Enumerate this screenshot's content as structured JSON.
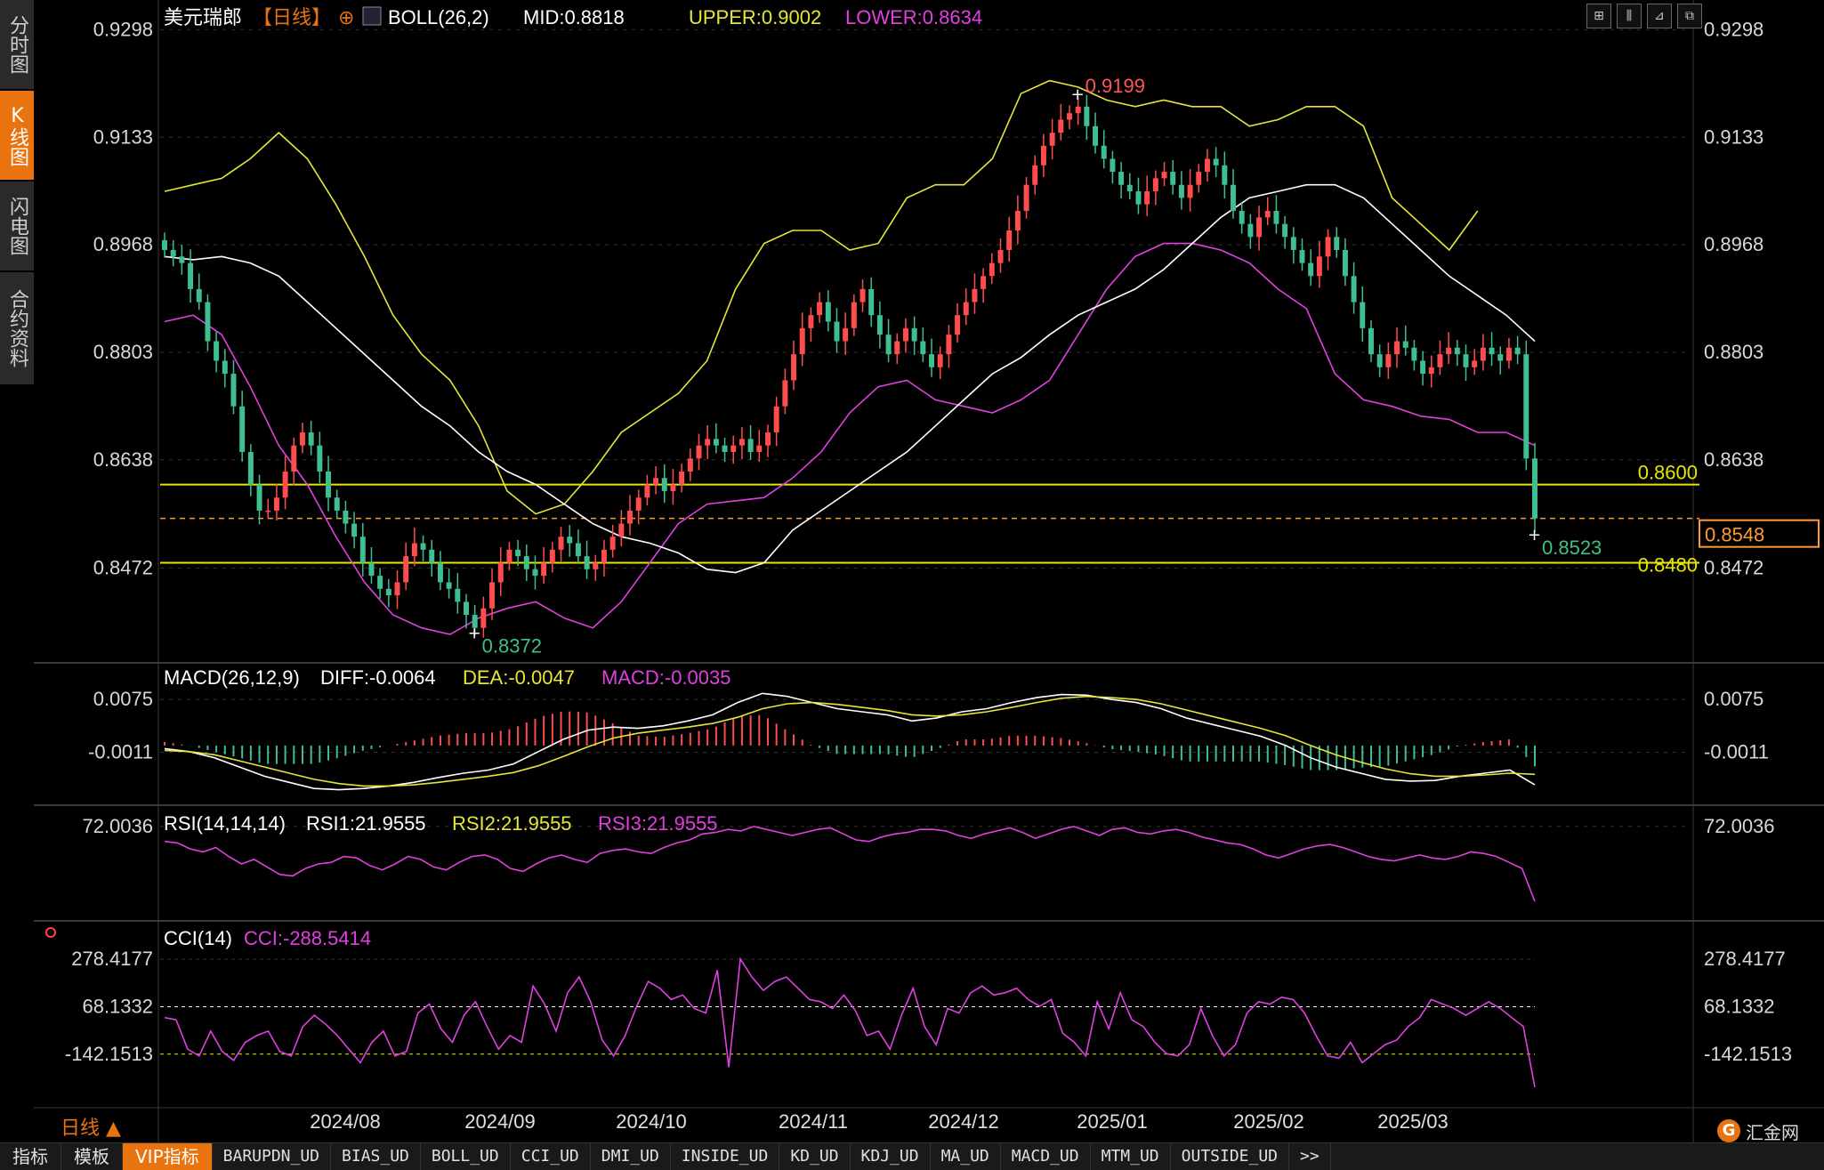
{
  "side_tabs": [
    {
      "label": "分时图",
      "active": false
    },
    {
      "label": "K线图",
      "active": true
    },
    {
      "label": "闪电图",
      "active": false
    },
    {
      "label": "合约资料",
      "active": false
    }
  ],
  "header": {
    "symbol": "美元瑞郎",
    "period": "【日线】",
    "plus_icon": "⊕",
    "boll": "BOLL(26,2)",
    "mid": "MID:0.8818",
    "upper": "UPPER:0.9002",
    "lower": "LOWER:0.8634"
  },
  "macd_header": {
    "name": "MACD(26,12,9)",
    "diff": "DIFF:-0.0064",
    "dea": "DEA:-0.0047",
    "macd": "MACD:-0.0035"
  },
  "rsi_header": {
    "name": "RSI(14,14,14)",
    "rsi1": "RSI1:21.9555",
    "rsi2": "RSI2:21.9555",
    "rsi3": "RSI3:21.9555"
  },
  "cci_header": {
    "name": "CCI(14)",
    "cci": "CCI:-288.5414"
  },
  "period_label": "日线 ▲",
  "toolbar_icons": [
    "crosshair-icon",
    "candle-icon",
    "chart-icon",
    "fullscreen-icon"
  ],
  "bottom_tabs": [
    {
      "label": "指标",
      "active": false
    },
    {
      "label": "模板",
      "active": false
    },
    {
      "label": "VIP指标",
      "active": true
    },
    {
      "label": "BARUPDN_UD",
      "active": false
    },
    {
      "label": "BIAS_UD",
      "active": false
    },
    {
      "label": "BOLL_UD",
      "active": false
    },
    {
      "label": "CCI_UD",
      "active": false
    },
    {
      "label": "DMI_UD",
      "active": false
    },
    {
      "label": "INSIDE_UD",
      "active": false
    },
    {
      "label": "KD_UD",
      "active": false
    },
    {
      "label": "KDJ_UD",
      "active": false
    },
    {
      "label": "MA_UD",
      "active": false
    },
    {
      "label": "MACD_UD",
      "active": false
    },
    {
      "label": "MTM_UD",
      "active": false
    },
    {
      "label": "OUTSIDE_UD",
      "active": false
    },
    {
      "label": ">>",
      "active": false
    }
  ],
  "logo": {
    "text": "汇金网",
    "mark": "G"
  },
  "colors": {
    "up": "#ff4d4d",
    "down": "#3fbf8f",
    "mid": "#ffffff",
    "upper": "#e6e63a",
    "lower": "#e040e0",
    "dea": "#e6e63a",
    "macd": "#e040e0",
    "rsi": "#e040e0",
    "cci": "#e040e0",
    "hline": "#e6e600",
    "price_line": "#ff9933",
    "high_label": "#ff5555",
    "low_label": "#40c080"
  },
  "chart_data": {
    "type": "candlestick",
    "x_ticks": [
      "2024/08",
      "2024/09",
      "2024/10",
      "2024/11",
      "2024/12",
      "2025/01",
      "2025/02",
      "2025/03"
    ],
    "price_axis": {
      "ticks": [
        "0.9298",
        "0.9133",
        "0.8968",
        "0.8803",
        "0.8638",
        "0.8472"
      ],
      "range": [
        0.834,
        0.933
      ]
    },
    "horizontal_lines": [
      {
        "value": 0.86,
        "label": "0.8600"
      },
      {
        "value": 0.848,
        "label": "0.8480"
      }
    ],
    "current_price": {
      "value": 0.8548,
      "label": "0.8548"
    },
    "annotations": [
      {
        "label": "0.9199",
        "value": 0.9199,
        "type": "high",
        "index": 106
      },
      {
        "label": "0.8372",
        "value": 0.8372,
        "type": "low",
        "index": 36
      },
      {
        "label": "0.8523",
        "value": 0.8523,
        "type": "last-low",
        "index": 159
      }
    ],
    "boll": {
      "mid": [
        0.895,
        0.8945,
        0.895,
        0.894,
        0.892,
        0.888,
        0.884,
        0.88,
        0.876,
        0.872,
        0.869,
        0.865,
        0.862,
        0.86,
        0.857,
        0.854,
        0.852,
        0.851,
        0.8495,
        0.847,
        0.8465,
        0.848,
        0.853,
        0.856,
        0.859,
        0.862,
        0.865,
        0.869,
        0.873,
        0.877,
        0.8795,
        0.883,
        0.886,
        0.888,
        0.89,
        0.893,
        0.897,
        0.901,
        0.904,
        0.905,
        0.906,
        0.906,
        0.904,
        0.9,
        0.896,
        0.892,
        0.889,
        0.886,
        0.882
      ],
      "upper": [
        0.905,
        0.906,
        0.907,
        0.91,
        0.914,
        0.91,
        0.903,
        0.895,
        0.886,
        0.88,
        0.876,
        0.869,
        0.859,
        0.8555,
        0.857,
        0.862,
        0.868,
        0.871,
        0.874,
        0.879,
        0.89,
        0.897,
        0.899,
        0.899,
        0.896,
        0.897,
        0.904,
        0.906,
        0.906,
        0.91,
        0.92,
        0.922,
        0.921,
        0.919,
        0.918,
        0.919,
        0.918,
        0.918,
        0.915,
        0.916,
        0.918,
        0.918,
        0.915,
        0.904,
        0.9,
        0.896,
        0.902,
        null,
        null
      ],
      "lower": [
        0.885,
        0.886,
        0.883,
        0.875,
        0.866,
        0.86,
        0.852,
        0.845,
        0.84,
        0.838,
        0.837,
        0.8395,
        0.841,
        0.842,
        0.8395,
        0.838,
        0.842,
        0.848,
        0.854,
        0.857,
        0.8575,
        0.858,
        0.861,
        0.865,
        0.871,
        0.875,
        0.876,
        0.873,
        0.872,
        0.871,
        0.873,
        0.876,
        0.883,
        0.89,
        0.895,
        0.897,
        0.897,
        0.896,
        0.894,
        0.89,
        0.887,
        0.877,
        0.873,
        0.872,
        0.8705,
        0.87,
        0.868,
        0.868,
        0.866
      ]
    },
    "close": [
      0.896,
      0.895,
      0.894,
      0.89,
      0.888,
      0.882,
      0.879,
      0.877,
      0.872,
      0.865,
      0.86,
      0.856,
      0.856,
      0.858,
      0.862,
      0.866,
      0.868,
      0.866,
      0.862,
      0.858,
      0.856,
      0.854,
      0.852,
      0.848,
      0.846,
      0.844,
      0.843,
      0.845,
      0.849,
      0.851,
      0.85,
      0.848,
      0.845,
      0.844,
      0.842,
      0.84,
      0.838,
      0.841,
      0.845,
      0.848,
      0.85,
      0.849,
      0.847,
      0.846,
      0.848,
      0.85,
      0.852,
      0.851,
      0.849,
      0.847,
      0.848,
      0.85,
      0.852,
      0.854,
      0.856,
      0.858,
      0.86,
      0.861,
      0.859,
      0.86,
      0.862,
      0.864,
      0.866,
      0.867,
      0.866,
      0.865,
      0.866,
      0.867,
      0.865,
      0.866,
      0.868,
      0.872,
      0.876,
      0.88,
      0.884,
      0.886,
      0.888,
      0.885,
      0.882,
      0.884,
      0.888,
      0.89,
      0.886,
      0.883,
      0.88,
      0.882,
      0.884,
      0.882,
      0.88,
      0.878,
      0.88,
      0.883,
      0.886,
      0.888,
      0.89,
      0.892,
      0.894,
      0.896,
      0.899,
      0.902,
      0.906,
      0.909,
      0.912,
      0.914,
      0.916,
      0.917,
      0.918,
      0.915,
      0.912,
      0.91,
      0.908,
      0.906,
      0.905,
      0.903,
      0.905,
      0.907,
      0.908,
      0.906,
      0.904,
      0.906,
      0.908,
      0.91,
      0.909,
      0.906,
      0.902,
      0.9,
      0.898,
      0.901,
      0.902,
      0.9,
      0.898,
      0.896,
      0.894,
      0.892,
      0.895,
      0.898,
      0.896,
      0.892,
      0.888,
      0.884,
      0.88,
      0.878,
      0.88,
      0.882,
      0.881,
      0.879,
      0.877,
      0.878,
      0.88,
      0.881,
      0.88,
      0.878,
      0.879,
      0.881,
      0.88,
      0.879,
      0.881,
      0.88,
      0.864,
      0.8548
    ],
    "macd": {
      "diff": [
        -0.0005,
        -0.001,
        -0.002,
        -0.0035,
        -0.005,
        -0.006,
        -0.007,
        -0.0072,
        -0.007,
        -0.0066,
        -0.006,
        -0.0052,
        -0.0045,
        -0.004,
        -0.003,
        -0.001,
        0.001,
        0.0025,
        0.003,
        0.0028,
        0.0032,
        0.004,
        0.005,
        0.007,
        0.0085,
        0.008,
        0.007,
        0.006,
        0.0055,
        0.005,
        0.004,
        0.0045,
        0.0055,
        0.006,
        0.007,
        0.0078,
        0.0083,
        0.0082,
        0.0075,
        0.007,
        0.006,
        0.0045,
        0.0035,
        0.0025,
        0.0015,
        0.0,
        -0.002,
        -0.0035,
        -0.0045,
        -0.0055,
        -0.0058,
        -0.0057,
        -0.005,
        -0.0045,
        -0.004,
        -0.0064
      ],
      "dea": [
        -0.0008,
        -0.001,
        -0.0015,
        -0.0025,
        -0.0035,
        -0.0045,
        -0.0055,
        -0.0062,
        -0.0066,
        -0.0066,
        -0.0064,
        -0.006,
        -0.0055,
        -0.005,
        -0.0044,
        -0.0033,
        -0.0018,
        -0.0002,
        0.0012,
        0.002,
        0.0025,
        0.003,
        0.0036,
        0.0046,
        0.006,
        0.0068,
        0.007,
        0.0067,
        0.0062,
        0.0057,
        0.005,
        0.0048,
        0.005,
        0.0055,
        0.0062,
        0.007,
        0.0077,
        0.008,
        0.0078,
        0.0075,
        0.0068,
        0.0058,
        0.0048,
        0.0038,
        0.0028,
        0.0016,
        0.0,
        -0.0015,
        -0.0027,
        -0.0038,
        -0.0046,
        -0.005,
        -0.005,
        -0.0048,
        -0.0045,
        -0.0047
      ],
      "ticks": [
        "0.0075",
        "-0.0011"
      ],
      "range": [
        -0.009,
        0.011
      ]
    },
    "rsi": {
      "values": [
        62,
        61,
        57,
        55,
        58,
        52,
        47,
        50,
        45,
        40,
        39,
        44,
        47,
        48,
        52,
        51,
        46,
        43,
        47,
        52,
        50,
        45,
        43,
        48,
        52,
        53,
        50,
        44,
        42,
        47,
        51,
        53,
        50,
        48,
        54,
        56,
        57,
        55,
        54,
        58,
        61,
        63,
        67,
        68,
        70,
        69,
        72,
        70,
        68,
        66,
        68,
        70,
        71,
        67,
        63,
        62,
        65,
        67,
        68,
        70,
        70,
        69,
        66,
        64,
        67,
        69,
        71,
        68,
        64,
        67,
        70,
        72,
        69,
        66,
        70,
        71,
        68,
        67,
        69,
        70,
        68,
        65,
        63,
        61,
        60,
        57,
        53,
        51,
        54,
        57,
        59,
        60,
        58,
        55,
        52,
        50,
        49,
        51,
        53,
        51,
        50,
        52,
        55,
        54,
        52,
        48,
        44,
        22
      ],
      "tick": "72.0036",
      "range": [
        12,
        82
      ]
    },
    "cci": {
      "values": [
        20,
        10,
        -120,
        -150,
        -40,
        -130,
        -170,
        -90,
        -60,
        -40,
        -130,
        -150,
        -20,
        30,
        -10,
        -60,
        -120,
        -180,
        -90,
        -40,
        -150,
        -130,
        40,
        80,
        -30,
        -90,
        30,
        90,
        -20,
        -120,
        -60,
        -90,
        160,
        80,
        -40,
        130,
        200,
        90,
        -80,
        -150,
        -60,
        70,
        180,
        150,
        100,
        120,
        60,
        40,
        230,
        -200,
        280,
        200,
        140,
        180,
        200,
        150,
        100,
        90,
        60,
        120,
        50,
        -60,
        -40,
        -120,
        30,
        150,
        -20,
        -100,
        60,
        40,
        130,
        160,
        120,
        130,
        150,
        100,
        70,
        100,
        -50,
        -90,
        -150,
        90,
        -30,
        130,
        10,
        -20,
        -90,
        -140,
        -150,
        -100,
        60,
        -60,
        -150,
        -100,
        40,
        90,
        80,
        110,
        100,
        40,
        -60,
        -150,
        -160,
        -90,
        -180,
        -140,
        -100,
        -80,
        -20,
        20,
        100,
        80,
        60,
        30,
        60,
        90,
        60,
        20,
        -20,
        -288.5414
      ],
      "ticks": [
        "278.4177",
        "68.1332",
        "-142.1513"
      ],
      "range": [
        -360,
        350
      ]
    }
  }
}
